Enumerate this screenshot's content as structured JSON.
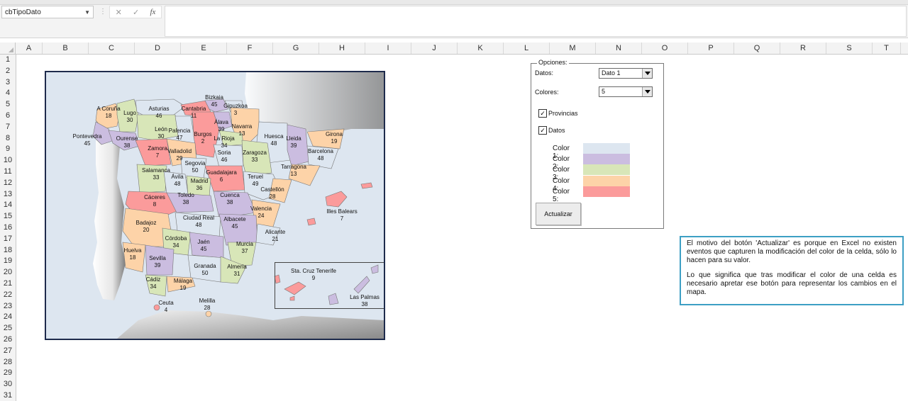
{
  "formula_bar": {
    "name_box": "cbTipoDato",
    "cancel_icon": "✕",
    "enter_icon": "✓",
    "fx_icon": "fx",
    "value": ""
  },
  "columns": [
    "A",
    "B",
    "C",
    "D",
    "E",
    "F",
    "G",
    "H",
    "I",
    "J",
    "K",
    "L",
    "M",
    "N",
    "O",
    "P",
    "Q",
    "R",
    "S",
    "T"
  ],
  "rows": [
    "1",
    "2",
    "3",
    "4",
    "5",
    "6",
    "7",
    "8",
    "9",
    "10",
    "11",
    "12",
    "13",
    "14",
    "15",
    "16",
    "17",
    "18",
    "19",
    "20",
    "21",
    "22",
    "23",
    "24",
    "25",
    "26",
    "27",
    "28",
    "29",
    "30",
    "31"
  ],
  "map": {
    "provinces": [
      {
        "name": "A Coruña",
        "value": "18"
      },
      {
        "name": "Lugo",
        "value": "30"
      },
      {
        "name": "Asturias",
        "value": "46"
      },
      {
        "name": "Cantabria",
        "value": "11"
      },
      {
        "name": "Bizkaia",
        "value": "45"
      },
      {
        "name": "Gipuzkoa",
        "value": "3"
      },
      {
        "name": "Pontevedra",
        "value": "45"
      },
      {
        "name": "Ourense",
        "value": "38"
      },
      {
        "name": "León",
        "value": "30"
      },
      {
        "name": "Palencia",
        "value": "47"
      },
      {
        "name": "Burgos",
        "value": "2"
      },
      {
        "name": "Álava",
        "value": "39"
      },
      {
        "name": "Navarra",
        "value": "13"
      },
      {
        "name": "La Rioja",
        "value": "34"
      },
      {
        "name": "Huesca",
        "value": "48"
      },
      {
        "name": "Lleida",
        "value": "39"
      },
      {
        "name": "Girona",
        "value": "19"
      },
      {
        "name": "Barcelona",
        "value": "48"
      },
      {
        "name": "Zamora",
        "value": "7"
      },
      {
        "name": "Valladolid",
        "value": "29"
      },
      {
        "name": "Soria",
        "value": "46"
      },
      {
        "name": "Zaragoza",
        "value": "33"
      },
      {
        "name": "Tarragona",
        "value": "13"
      },
      {
        "name": "Salamanca",
        "value": "33"
      },
      {
        "name": "Segovia",
        "value": "50"
      },
      {
        "name": "Guadalajara",
        "value": "6"
      },
      {
        "name": "Ávila",
        "value": "48"
      },
      {
        "name": "Madrid",
        "value": "36"
      },
      {
        "name": "Teruel",
        "value": "49"
      },
      {
        "name": "Castellón",
        "value": "28"
      },
      {
        "name": "Cáceres",
        "value": "8"
      },
      {
        "name": "Toledo",
        "value": "38"
      },
      {
        "name": "Cuenca",
        "value": "38"
      },
      {
        "name": "Valencia",
        "value": "24"
      },
      {
        "name": "Illes Balears",
        "value": "7"
      },
      {
        "name": "Ciudad Real",
        "value": "48"
      },
      {
        "name": "Albacete",
        "value": "45"
      },
      {
        "name": "Badajoz",
        "value": "20"
      },
      {
        "name": "Alicante",
        "value": "21"
      },
      {
        "name": "Córdoba",
        "value": "34"
      },
      {
        "name": "Jaén",
        "value": "45"
      },
      {
        "name": "Murcia",
        "value": "37"
      },
      {
        "name": "Huelva",
        "value": "18"
      },
      {
        "name": "Sevilla",
        "value": "39"
      },
      {
        "name": "Granada",
        "value": "50"
      },
      {
        "name": "Almería",
        "value": "31"
      },
      {
        "name": "Cádiz",
        "value": "34"
      },
      {
        "name": "Málaga",
        "value": "19"
      },
      {
        "name": "Sta. Cruz Tenerife",
        "value": "9"
      },
      {
        "name": "Las Palmas",
        "value": "38"
      },
      {
        "name": "Ceuta",
        "value": "4"
      },
      {
        "name": "Melilla",
        "value": "28"
      }
    ]
  },
  "options": {
    "legend": "Opciones:",
    "datos_label": "Datos:",
    "datos_value": "Dato 1",
    "colores_label": "Colores:",
    "colores_value": "5",
    "provincias_label": "Provincias",
    "provincias_checked": "✓",
    "datos_check_label": "Datos",
    "datos_checked": "✓",
    "colors": [
      {
        "label": "Color 1:",
        "hex": "#dde6f0"
      },
      {
        "label": "Color 2:",
        "hex": "#cbbde0"
      },
      {
        "label": "Color 3:",
        "hex": "#d8e6b8"
      },
      {
        "label": "Color 4:",
        "hex": "#fdd3a8"
      },
      {
        "label": "Color 5:",
        "hex": "#fb9b9b"
      }
    ],
    "button_label": "Actualizar"
  },
  "note": {
    "paragraph1": "El motivo del botón 'Actualizar' es porque en Excel no existen eventos que capturen la modificación del color de la celda, sólo lo hacen para su valor.",
    "paragraph2": "Lo que significa que tras modificar el color de una celda es necesario apretar ese botón para representar los cambios en el mapa."
  }
}
